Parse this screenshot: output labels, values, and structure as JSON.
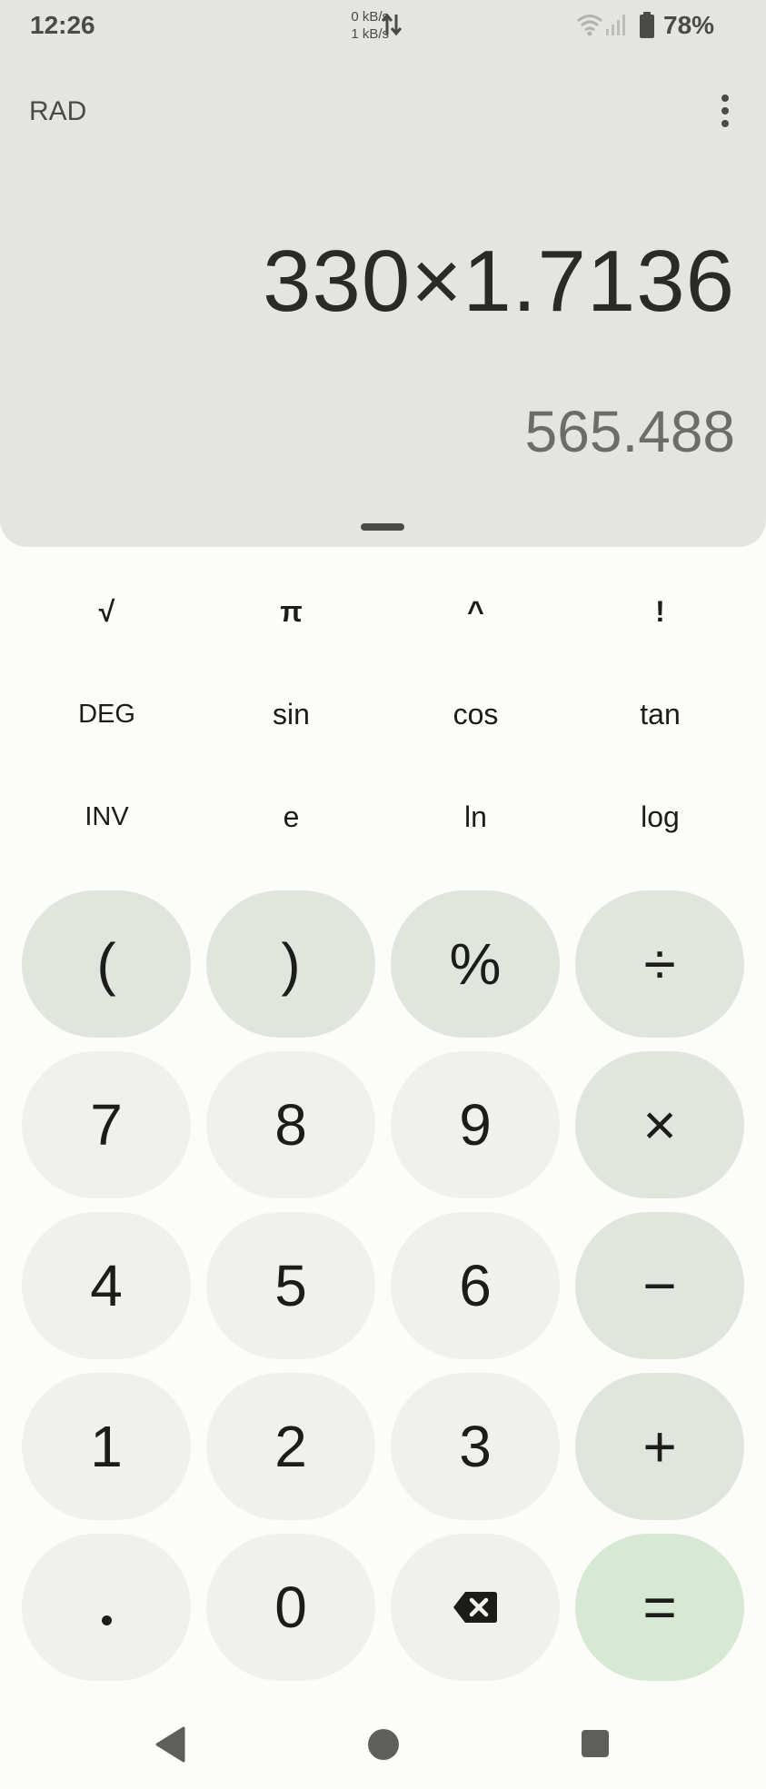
{
  "status_bar": {
    "time": "12:26",
    "net_up": "0 kB/s",
    "net_down": "1 kB/s",
    "battery": "78%"
  },
  "header": {
    "angle_mode": "RAD",
    "menu_icon": "more-vert-icon"
  },
  "display": {
    "expression": "330×1.7136",
    "result": "565.488"
  },
  "scientific_keys": [
    {
      "label": "√",
      "name": "sqrt-key"
    },
    {
      "label": "π",
      "name": "pi-key"
    },
    {
      "label": "^",
      "name": "power-key"
    },
    {
      "label": "!",
      "name": "factorial-key"
    },
    {
      "label": "DEG",
      "name": "deg-key"
    },
    {
      "label": "sin",
      "name": "sin-key"
    },
    {
      "label": "cos",
      "name": "cos-key"
    },
    {
      "label": "tan",
      "name": "tan-key"
    },
    {
      "label": "INV",
      "name": "inv-key"
    },
    {
      "label": "e",
      "name": "e-key"
    },
    {
      "label": "ln",
      "name": "ln-key"
    },
    {
      "label": "log",
      "name": "log-key"
    }
  ],
  "keypad": [
    {
      "label": "(",
      "name": "open-paren-key",
      "kind": "op"
    },
    {
      "label": ")",
      "name": "close-paren-key",
      "kind": "op"
    },
    {
      "label": "%",
      "name": "percent-key",
      "kind": "op"
    },
    {
      "label": "÷",
      "name": "divide-key",
      "kind": "op"
    },
    {
      "label": "7",
      "name": "digit-7-key",
      "kind": "num"
    },
    {
      "label": "8",
      "name": "digit-8-key",
      "kind": "num"
    },
    {
      "label": "9",
      "name": "digit-9-key",
      "kind": "num"
    },
    {
      "label": "×",
      "name": "multiply-key",
      "kind": "op"
    },
    {
      "label": "4",
      "name": "digit-4-key",
      "kind": "num"
    },
    {
      "label": "5",
      "name": "digit-5-key",
      "kind": "num"
    },
    {
      "label": "6",
      "name": "digit-6-key",
      "kind": "num"
    },
    {
      "label": "−",
      "name": "minus-key",
      "kind": "op"
    },
    {
      "label": "1",
      "name": "digit-1-key",
      "kind": "num"
    },
    {
      "label": "2",
      "name": "digit-2-key",
      "kind": "num"
    },
    {
      "label": "3",
      "name": "digit-3-key",
      "kind": "num"
    },
    {
      "label": "+",
      "name": "plus-key",
      "kind": "op"
    },
    {
      "label": ".",
      "name": "decimal-key",
      "kind": "num"
    },
    {
      "label": "0",
      "name": "digit-0-key",
      "kind": "num"
    },
    {
      "label": "",
      "name": "backspace-key",
      "kind": "num",
      "icon": "backspace-icon"
    },
    {
      "label": "=",
      "name": "equals-key",
      "kind": "eq"
    }
  ],
  "nav_bar": {
    "back_icon": "back-triangle-icon",
    "home_icon": "home-circle-icon",
    "recents_icon": "recents-square-icon"
  },
  "colors": {
    "display_bg": "#e4e4e1",
    "page_bg": "#fcfcf8",
    "number_key": "#f0f0ee",
    "operator_key": "#e0e5de",
    "equals_key": "#d7e8d4"
  }
}
